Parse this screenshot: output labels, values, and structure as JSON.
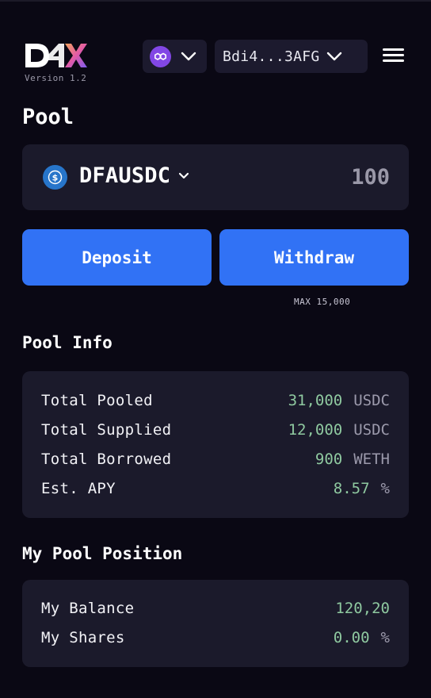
{
  "header": {
    "logo_text": "D4X",
    "version": "Version 1.2",
    "network_icon": "polygon-icon",
    "wallet_address": "Bdi4...3AFG"
  },
  "page": {
    "title": "Pool"
  },
  "pool_selector": {
    "token_icon": "usdc-icon",
    "pool_name": "DFAUSDC",
    "amount_value": "100"
  },
  "actions": {
    "deposit_label": "Deposit",
    "withdraw_label": "Withdraw",
    "max_note": "MAX 15,000"
  },
  "pool_info": {
    "title": "Pool Info",
    "rows": [
      {
        "label": "Total Pooled",
        "value": "31,000",
        "unit": "USDC"
      },
      {
        "label": "Total Supplied",
        "value": "12,000",
        "unit": "USDC"
      },
      {
        "label": "Total Borrowed",
        "value": "900",
        "unit": "WETH"
      },
      {
        "label": "Est. APY",
        "value": "8.57",
        "unit": "%"
      }
    ]
  },
  "my_position": {
    "title": "My Pool Position",
    "rows": [
      {
        "label": "My Balance",
        "value": "120,20",
        "unit": ""
      },
      {
        "label": "My Shares",
        "value": "0.00",
        "unit": "%"
      }
    ]
  },
  "colors": {
    "background": "#0a0814",
    "card": "#1b1a2b",
    "accent_blue": "#3172f5",
    "value_green": "#8fc9a0",
    "polygon_purple": "#8247e5",
    "usdc_blue": "#2775ca"
  }
}
